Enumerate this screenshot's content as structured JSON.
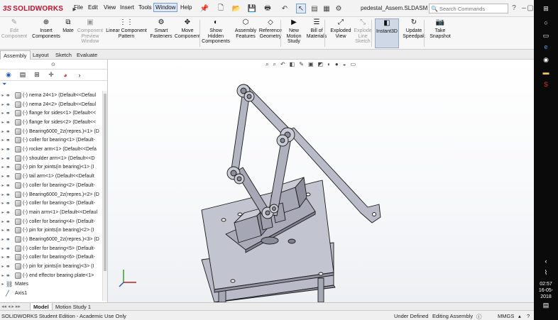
{
  "app": {
    "logo_ds": "3S",
    "logo_name": "SOLIDWORKS"
  },
  "menu": [
    "File",
    "Edit",
    "View",
    "Insert",
    "Tools",
    "Window",
    "Help"
  ],
  "active_menu": "Window",
  "document_title": "pedestal_Assem.SLDASM *",
  "search": {
    "placeholder": "Search Commands"
  },
  "ribbon": [
    {
      "label": "Edit\nComponent",
      "icon": "edit-component-icon",
      "disabled": true
    },
    {
      "label": "Insert\nComponents",
      "icon": "insert-components-icon",
      "disabled": false
    },
    {
      "label": "Mate",
      "icon": "mate-icon",
      "disabled": false
    },
    {
      "label": "Component\nPreview\nWindow",
      "icon": "preview-window-icon",
      "disabled": true
    },
    {
      "label": "Linear Component\nPattern",
      "icon": "linear-pattern-icon",
      "disabled": false
    },
    {
      "label": "Smart\nFasteners",
      "icon": "smart-fasteners-icon",
      "disabled": false
    },
    {
      "label": "Move\nComponent",
      "icon": "move-component-icon",
      "disabled": false
    },
    {
      "label": "Show\nHidden\nComponents",
      "icon": "show-hidden-icon",
      "disabled": false
    },
    {
      "label": "Assembly\nFeatures",
      "icon": "assembly-features-icon",
      "disabled": false
    },
    {
      "label": "Reference\nGeometry",
      "icon": "reference-geometry-icon",
      "disabled": false
    },
    {
      "label": "New\nMotion\nStudy",
      "icon": "motion-study-icon",
      "disabled": false
    },
    {
      "label": "Bill of\nMaterials",
      "icon": "bom-icon",
      "disabled": false
    },
    {
      "label": "Exploded\nView",
      "icon": "exploded-view-icon",
      "disabled": false
    },
    {
      "label": "Explode\nLine\nSketch",
      "icon": "explode-line-icon",
      "disabled": true
    },
    {
      "label": "Instant3D",
      "icon": "instant3d-icon",
      "disabled": false,
      "selected": true
    },
    {
      "label": "Update\nSpeedpak",
      "icon": "speedpak-icon",
      "disabled": false
    },
    {
      "label": "Take\nSnapshot",
      "icon": "camera-icon",
      "disabled": false
    }
  ],
  "command_tabs": [
    "Assembly",
    "Layout",
    "Sketch",
    "Evaluate"
  ],
  "active_command_tab": "Assembly",
  "tree": {
    "items": [
      "(-) nema 24<1> (Default<<Defaul",
      "(-) nema 24<2> (Default<<Defaul",
      "(-) flange for sides<1> (Default<<",
      "(-) flange for sides<2> (Default<<",
      "(-) Bearing6000_2z(repres.)<1> (D",
      "(-) coller for bearing<1> (Default-",
      "(-) rocker arm<1> (Default<<Defa",
      "(-) shoulder arm<1> (Default<<D",
      "(-) pin for joints(in bearing)<1> (I",
      "(-) tail arm<1> (Default<<Default",
      "(-) coller for bearing<2> (Default-",
      "(-) Bearing6000_2z(repres.)<2> (D",
      "(-) coller for bearing<3> (Default-",
      "(-) main arm<1> (Default<<Defaul",
      "(-) coller for bearing<4> (Default-",
      "(-) pin for joints(in bearing)<2> (I",
      "(-) Bearing6000_2z(repres.)<3> (D",
      "(-) coller for bearing<5> (Default-",
      "(-) coller for bearing<6> (Default-",
      "(-) pin for joints(in bearing)<3> (I",
      "(-) end effector bearing plate<1>"
    ],
    "mates_label": "Mates",
    "axis_label": "Axis1"
  },
  "model_tabs": [
    "Model",
    "Motion Study 1"
  ],
  "active_model_tab": "Model",
  "status": {
    "edition": "SOLIDWORKS Student Edition - Academic Use Only",
    "definition": "Under Defined",
    "mode": "Editing Assembly",
    "units": "MMGS"
  },
  "clock": {
    "time": "02:57",
    "date": "16-05-2018"
  },
  "colors": {
    "brand": "#c8102e",
    "model_face": "#b9bbc8",
    "model_edge": "#1a1a1a",
    "ribbon_selected": "#cfd8e6"
  }
}
